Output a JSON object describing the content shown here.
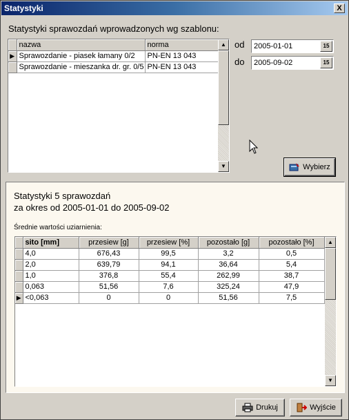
{
  "window": {
    "title": "Statystyki",
    "close_label": "X"
  },
  "templates": {
    "heading": "Statystyki sprawozdań wprowadzonych wg szablonu:",
    "columns": [
      "nazwa",
      "norma"
    ],
    "rows": [
      {
        "nazwa": "Sprawozdanie - piasek łamany 0/2",
        "norma": "PN-EN 13 043",
        "current": true
      },
      {
        "nazwa": "Sprawozdanie - mieszanka dr. gr. 0/5",
        "norma": "PN-EN 13 043",
        "current": false
      }
    ]
  },
  "date_from": {
    "label": "od",
    "value": "2005-01-01",
    "calendar_label": "15"
  },
  "date_to": {
    "label": "do",
    "value": "2005-09-02",
    "calendar_label": "15"
  },
  "select_button": {
    "label": "Wybierz"
  },
  "results": {
    "title_line1": "Statystyki 5 sprawozdań",
    "title_line2": "za okres od 2005-01-01 do 2005-09-02",
    "subheading": "Średnie wartości uziarnienia:",
    "columns": [
      "sito [mm]",
      "przesiew [g]",
      "przesiew [%]",
      "pozostało [g]",
      "pozostało [%]"
    ],
    "rows": [
      {
        "sito": "4,0",
        "przesiew_g": "676,43",
        "przesiew_pct": "99,5",
        "pozostalo_g": "3,2",
        "pozostalo_pct": "0,5",
        "current": false
      },
      {
        "sito": "2,0",
        "przesiew_g": "639,79",
        "przesiew_pct": "94,1",
        "pozostalo_g": "36,64",
        "pozostalo_pct": "5,4",
        "current": false
      },
      {
        "sito": "1,0",
        "przesiew_g": "376,8",
        "przesiew_pct": "55,4",
        "pozostalo_g": "262,99",
        "pozostalo_pct": "38,7",
        "current": false
      },
      {
        "sito": "0,063",
        "przesiew_g": "51,56",
        "przesiew_pct": "7,6",
        "pozostalo_g": "325,24",
        "pozostalo_pct": "47,9",
        "current": false
      },
      {
        "sito": "<0,063",
        "przesiew_g": "0",
        "przesiew_pct": "0",
        "pozostalo_g": "51,56",
        "pozostalo_pct": "7,5",
        "current": true
      }
    ]
  },
  "footer": {
    "print_label": "Drukuj",
    "exit_label": "Wyjście"
  },
  "icons": {
    "close": "close-icon",
    "calendar": "calendar-icon",
    "select": "select-icon",
    "printer": "printer-icon",
    "exit": "exit-icon",
    "row_pointer": "row-pointer-icon",
    "cursor": "mouse-cursor-icon"
  }
}
